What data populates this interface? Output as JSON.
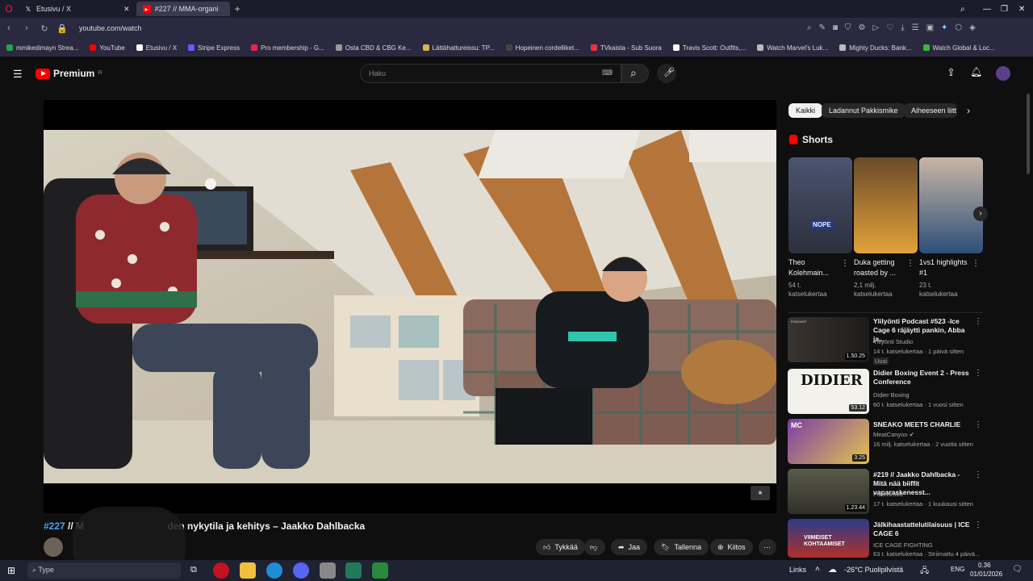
{
  "browser": {
    "tabs": [
      {
        "label": "Etusivu / X",
        "active": false
      },
      {
        "label": "#227 // MMA-organi",
        "active": true
      }
    ],
    "url": "youtube.com/watch",
    "bookmarks": [
      "mmikedimayn Strea...",
      "YouTube",
      "Etusivu / X",
      "Stripe Express",
      "Pro membership - G...",
      "Osta CBD & CBG Ke...",
      "Lättähattureissu: TP...",
      "Hopeinen cordelliket...",
      "TVkaista - Sub Suora",
      "Travis Scott: Outfits,...",
      "Watch Marvel's Luk...",
      "Mighty Ducks: Bank...",
      "Watch Global & Loc..."
    ]
  },
  "youtube": {
    "logo_text": "Premium",
    "logo_sup": "FI",
    "search_placeholder": "Haku"
  },
  "video": {
    "title_tag": "#227",
    "title_rest": " // M",
    "title_tail": "den nykytila ja kehitys – Jaakko Dahlbacka",
    "actions": {
      "like": "Tykkää",
      "share": "Jaa",
      "save": "Tallenna",
      "thanks": "Kiitos"
    }
  },
  "sidebar": {
    "chips": [
      "Kaikki",
      "Ladannut Pakkismike",
      "Aiheeseen liitt"
    ],
    "shorts_heading": "Shorts",
    "shorts": [
      {
        "title": "Theo Kolehmain...",
        "views": "54 t. katselukertaa"
      },
      {
        "title": "Duka getting roasted by ...",
        "views": "2,1 milj. katselukertaa"
      },
      {
        "title": "1vs1 highlights #1",
        "views": "23 t. katselukertaa"
      }
    ],
    "nope_label": "NOPE",
    "recommended": [
      {
        "title": "Ylilyönti Podcast #523 -Ice Cage 6 räjäytti pankin, Abba ja...",
        "channel": "Ylilyönti Studio",
        "meta": "14 t. katselukertaa · 1 päivä sitten",
        "badge": "Uusi",
        "duration": "1.50.25",
        "thumb_text": ""
      },
      {
        "title": "Didier Boxing Event 2 - Press Conference",
        "channel": "Didier Boxing",
        "meta": "60 t. katselukertaa · 1 vuosi sitten",
        "badge": "",
        "duration": "53.12",
        "thumb_text": "DIDIER"
      },
      {
        "title": "SNEAKO MEETS CHARLIE",
        "channel": "MeatCanyon",
        "meta": "16 milj. katselukertaa · 2 vuotta sitten",
        "badge": "",
        "duration": "3.25",
        "thumb_text": "MC"
      },
      {
        "title": "#219 // Jaakko Dahlbacka - Mitä nää biiffit vaparaskenesst...",
        "channel": "Pakkismike",
        "meta": "17 t. katselukertaa · 1 kuukausi sitten",
        "badge": "",
        "duration": "1.23.44",
        "thumb_text": ""
      },
      {
        "title": "Jälkihaastattelutilaisuus | ICE CAGE 6",
        "channel": "ICE CAGE FIGHTING",
        "meta": "63 t. katselukertaa · Striimattu 4 päivä...",
        "badge": "",
        "duration": "",
        "thumb_text": "VIIMEISET KOHTAAMISET"
      }
    ],
    "thumb_small_text": "PODCAST"
  },
  "taskbar": {
    "search_label": "Type",
    "links_label": "Links",
    "weather": "-26°C Puolipilvistä",
    "lang": "ENG",
    "time": "0.36",
    "date": "01/01/2026"
  }
}
